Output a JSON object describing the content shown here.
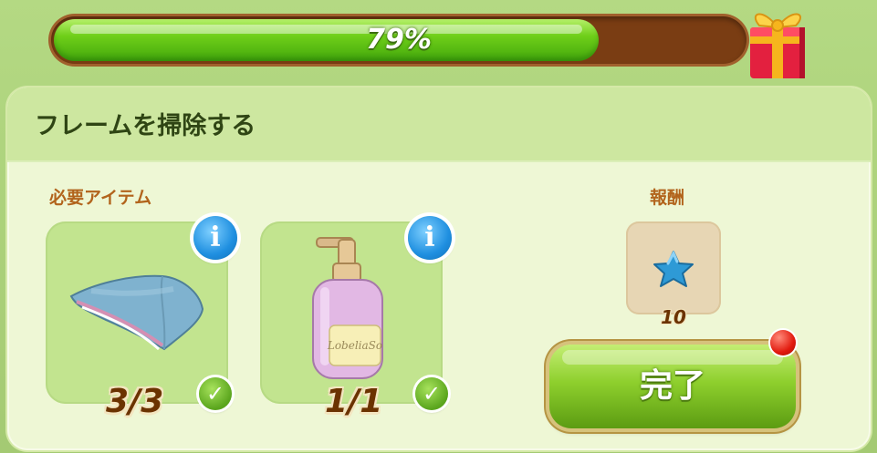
{
  "progress": {
    "percent_text": "79%",
    "fraction": 0.79
  },
  "panel": {
    "title": "フレームを掃除する",
    "required_label": "必要アイテム",
    "reward_label": "報酬"
  },
  "items": [
    {
      "icon": "cloth-icon",
      "count_text": "3/3"
    },
    {
      "icon": "soap-bottle-icon",
      "count_text": "1/1"
    }
  ],
  "reward": {
    "icon": "blue-star-icon",
    "count_text": "10"
  },
  "complete_button": {
    "label": "完了"
  },
  "colors": {
    "progress_fill": "#6fcf19",
    "progress_track": "#7a3d13",
    "panel_header": "#cde7a0",
    "accent_label": "#b2641c"
  }
}
